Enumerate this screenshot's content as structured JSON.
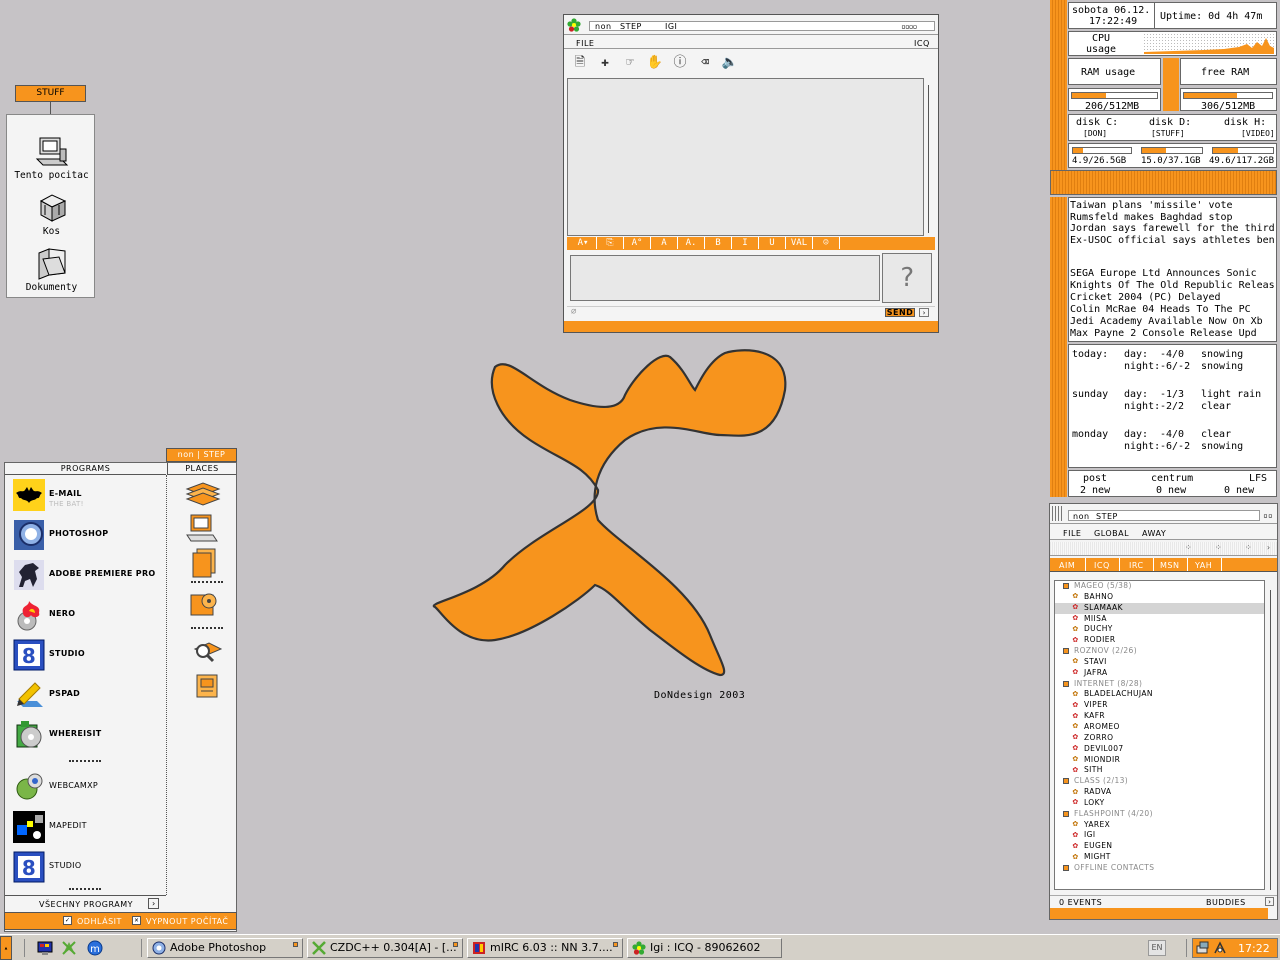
{
  "stuff": {
    "tab_label": "STUFF",
    "icons": [
      {
        "label": "Tento pocitac",
        "icon": "computer-icon"
      },
      {
        "label": "Kos",
        "icon": "trash-icon"
      },
      {
        "label": "Dokumenty",
        "icon": "folder-icon"
      }
    ]
  },
  "icq": {
    "title_left": "non",
    "title_right": "STEP",
    "title_user": "IGI",
    "menu_file": "FILE",
    "menu_icq": "ICQ",
    "format_buttons": [
      "A▾",
      "⎘",
      "A°",
      "A",
      "A.",
      "B",
      "I",
      "U",
      "VAL",
      "☺"
    ],
    "send_label": "SEND"
  },
  "wallpaper": {
    "credit": "DoNdesign 2003",
    "accent": "#f7941d"
  },
  "sysmon": {
    "date": "sobota 06.12.",
    "time": "17:22:49",
    "uptime": "Uptime: 0d 4h 47m",
    "cpu_label": "CPU usage",
    "ram_label": "RAM usage",
    "free_ram_label": "free RAM",
    "ram_used": "206/512MB",
    "ram_used_frac": 0.4,
    "ram_free": "306/512MB",
    "ram_free_frac": 0.6,
    "disks": [
      {
        "name": "disk C:",
        "tag": "[DON]",
        "value": "4.9/26.5GB",
        "frac": 0.18
      },
      {
        "name": "disk D:",
        "tag": "[STUFF]",
        "value": "15.0/37.1GB",
        "frac": 0.4
      },
      {
        "name": "disk H:",
        "tag": "[VIDEO]",
        "value": "49.6/117.2GB",
        "frac": 0.42
      }
    ]
  },
  "news": {
    "world": [
      "Taiwan plans 'missile' vote",
      "Rumsfeld makes Baghdad stop",
      "Jordan says farewell for the third t",
      "Ex-USOC official says athletes ben"
    ],
    "games": [
      "SEGA Europe Ltd Announces Sonic",
      "Knights Of The Old Republic Releas",
      "Cricket 2004 (PC) Delayed",
      "Colin McRae 04 Heads To The PC",
      "Jedi Academy Available Now On Xb",
      "Max Payne 2 Console Release Upd"
    ]
  },
  "weather": [
    {
      "day": "today:",
      "day_temp": "-4/0",
      "day_desc": "snowing",
      "night_temp": "-6/-2",
      "night_desc": "snowing"
    },
    {
      "day": "sunday",
      "day_temp": "-1/3",
      "day_desc": "light rain",
      "night_temp": "-2/2",
      "night_desc": "clear"
    },
    {
      "day": "monday",
      "day_temp": "-4/0",
      "day_desc": "clear",
      "night_temp": "-6/-2",
      "night_desc": "snowing"
    }
  ],
  "mail": [
    {
      "name": "post",
      "count": "2 new"
    },
    {
      "name": "centrum",
      "count": "0 new"
    },
    {
      "name": "LFS",
      "count": "0 new"
    }
  ],
  "buddy": {
    "title_left": "non",
    "title_right": "STEP",
    "menu": [
      "FILE",
      "GLOBAL",
      "AWAY"
    ],
    "tabs": [
      "AIM",
      "ICQ",
      "IRC",
      "MSN",
      "YAH"
    ],
    "groups": [
      {
        "name": "MAGEO (5/38)",
        "members": [
          "BAHNO",
          "SLAMAAK",
          "MIISA",
          "DUCHY",
          "RODIER"
        ]
      },
      {
        "name": "ROZNOV (2/26)",
        "members": [
          "STAVI",
          "JAFRA"
        ]
      },
      {
        "name": "INTERNET (8/28)",
        "members": [
          "BLADELACHUJAN",
          "VIPER",
          "KAFR",
          "AROMEO",
          "ZORRO",
          "DEVIL007",
          "MIONDIR",
          "SITH"
        ]
      },
      {
        "name": "CLASS (2/13)",
        "members": [
          "RADVA",
          "LOKY"
        ]
      },
      {
        "name": "FLASHPOINT (4/20)",
        "members": [
          "YAREX",
          "IGI",
          "EUGEN",
          "MIGHT"
        ]
      },
      {
        "name": "OFFLINE CONTACTS",
        "members": []
      }
    ],
    "events": "0 EVENTS",
    "buddies_label": "BUDDIES"
  },
  "start_menu": {
    "header": "non | STEP",
    "programs_title": "PROGRAMS",
    "places_title": "PLACES",
    "programs": [
      {
        "label": "E-MAIL",
        "sub": "THE BAT!"
      },
      {
        "label": "PHOTOSHOP",
        "sub": ""
      },
      {
        "label": "ADOBE PREMIERE PRO",
        "sub": ""
      },
      {
        "label": "NERO",
        "sub": ""
      },
      {
        "label": "STUDIO",
        "sub": ""
      },
      {
        "label": "PSPAD",
        "sub": ""
      },
      {
        "label": "WHEREISIT",
        "sub": ""
      },
      {
        "label": "WEBCAMXP",
        "sub": ""
      },
      {
        "label": "MAPEDIT",
        "sub": ""
      },
      {
        "label": "STUDIO",
        "sub": ""
      }
    ],
    "all_programs": "VŠECHNY PROGRAMY",
    "logoff": "ODHLÁSIT",
    "shutdown": "VYPNOUT POČÍTAČ"
  },
  "taskbar": {
    "tasks": [
      "Adobe Photoshop",
      "CZDC++ 0.304[A] - [...",
      "mIRC 6.03 :: NN 3.7....",
      "Igi : ICQ - 89062602"
    ],
    "lang": "EN",
    "clock": "17:22"
  }
}
